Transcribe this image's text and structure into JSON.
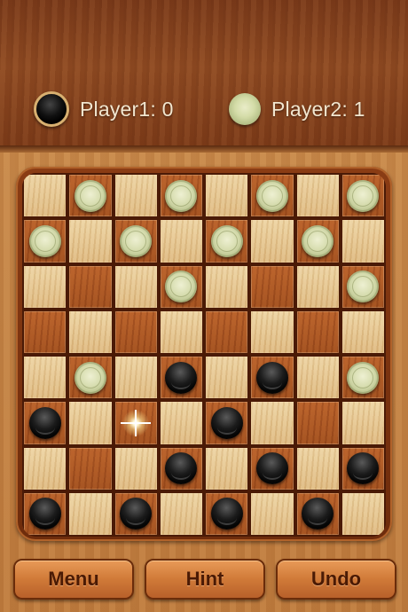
{
  "scoreboard": {
    "player1": {
      "label": "Player1: 0",
      "piece_color": "black"
    },
    "player2": {
      "label": "Player2: 1",
      "piece_color": "white"
    }
  },
  "board": {
    "size": 8,
    "rows": [
      [
        null,
        "w",
        null,
        "w",
        null,
        "w",
        null,
        "w"
      ],
      [
        "w",
        null,
        "w",
        null,
        "w",
        null,
        "w",
        null
      ],
      [
        null,
        null,
        null,
        "w",
        null,
        null,
        null,
        "w"
      ],
      [
        null,
        null,
        null,
        null,
        null,
        null,
        null,
        null
      ],
      [
        null,
        "w",
        null,
        "b",
        null,
        "b",
        null,
        "w"
      ],
      [
        "b",
        null,
        "sel",
        null,
        "b",
        null,
        null,
        null
      ],
      [
        null,
        null,
        null,
        "b",
        null,
        "b",
        null,
        "b"
      ],
      [
        "b",
        null,
        "b",
        null,
        "b",
        null,
        "b",
        null
      ]
    ],
    "colors": {
      "light_square": "#e6c690",
      "dark_square": "#ac5724",
      "frame": "#7a3410"
    }
  },
  "buttons": {
    "menu": "Menu",
    "hint": "Hint",
    "undo": "Undo"
  }
}
